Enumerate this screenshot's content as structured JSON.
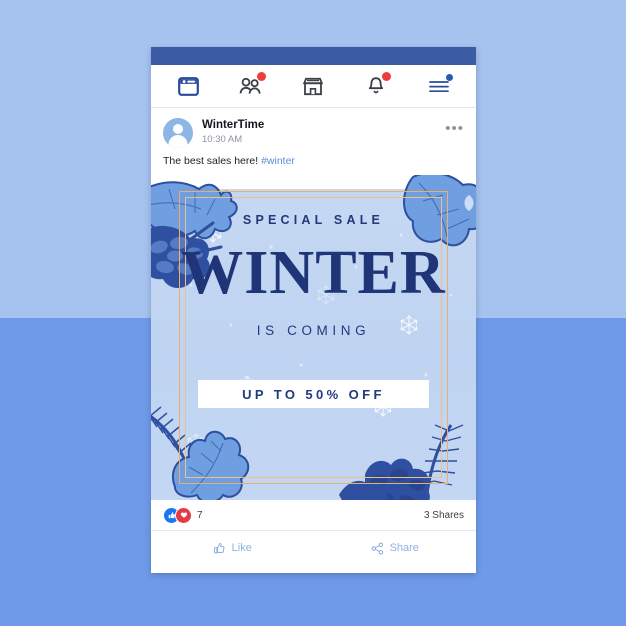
{
  "background": {
    "top_color": "#a6c2ee",
    "bottom_color": "#6f9ae8"
  },
  "card": {
    "topbar_color": "#3b5ba5"
  },
  "nav": {
    "items": [
      {
        "name": "news-feed-icon",
        "badge": null
      },
      {
        "name": "friends-icon",
        "badge": "red"
      },
      {
        "name": "marketplace-icon",
        "badge": null
      },
      {
        "name": "notifications-bell-icon",
        "badge": "red"
      },
      {
        "name": "menu-icon",
        "badge": "blue"
      }
    ]
  },
  "post": {
    "author": "WinterTime",
    "time": "10:30 AM",
    "more_label": "•••",
    "caption_text": "The best sales here!",
    "caption_tag": "#winter"
  },
  "creative": {
    "eyebrow": "SPECIAL SALE",
    "headline": "WINTER",
    "subhead": "IS COMING",
    "offer": "UP TO 50% OFF",
    "navy": "#22397a",
    "sky": "#c2d6f2",
    "frame_gold": "#e8b06a"
  },
  "footer": {
    "reaction_count": "7",
    "shares": "3 Shares",
    "like_label": "Like",
    "share_label": "Share"
  }
}
